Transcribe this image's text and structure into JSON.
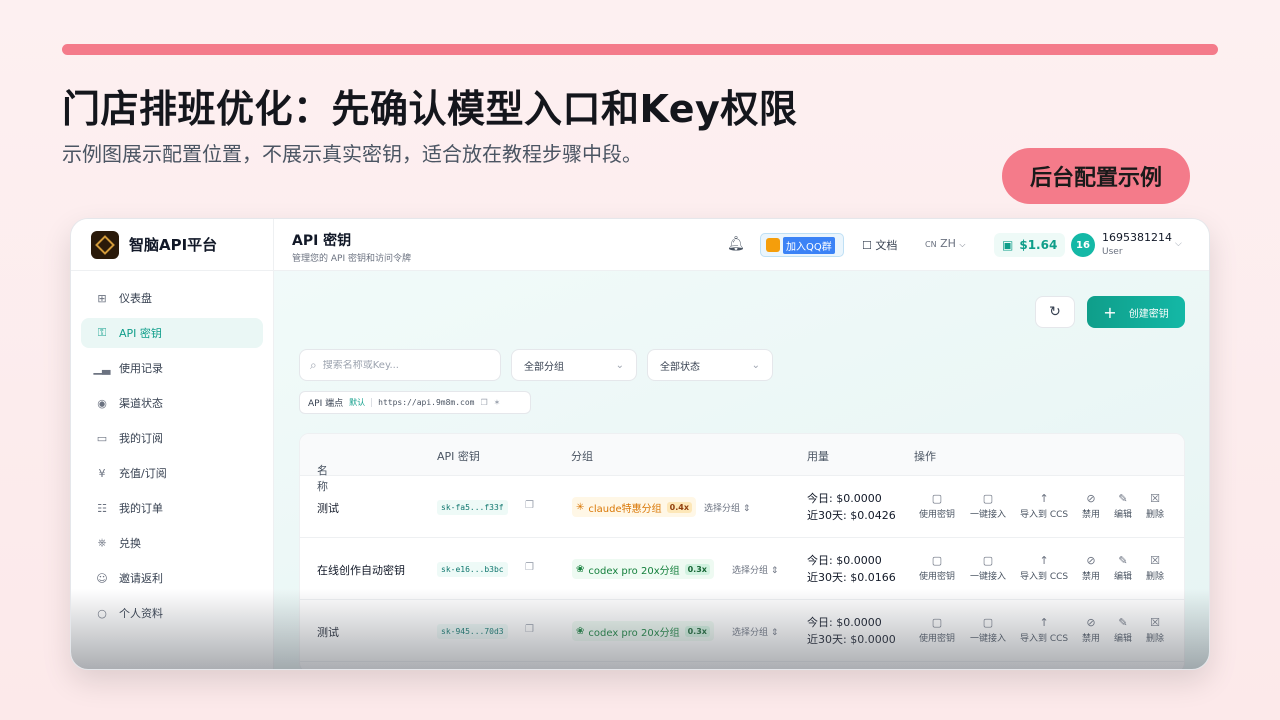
{
  "slide": {
    "headline": "门店排班优化：先确认模型入口和Key权限",
    "subline": "示例图展示配置位置，不展示真实密钥，适合放在教程步骤中段。",
    "pill": "后台配置示例",
    "accent": "#f47b8a"
  },
  "app": {
    "brand": "智脑API平台",
    "nav": [
      {
        "label": "仪表盘",
        "icon": "dashboard-icon"
      },
      {
        "label": "API 密钥",
        "icon": "key-icon",
        "active": true
      },
      {
        "label": "使用记录",
        "icon": "bar-chart-icon"
      },
      {
        "label": "渠道状态",
        "icon": "signal-icon"
      },
      {
        "label": "我的订阅",
        "icon": "card-icon"
      },
      {
        "label": "充值/订阅",
        "icon": "yen-icon"
      },
      {
        "label": "我的订单",
        "icon": "document-icon"
      },
      {
        "label": "兑换",
        "icon": "gift-icon"
      },
      {
        "label": "邀请返利",
        "icon": "users-icon"
      },
      {
        "label": "个人资料",
        "icon": "user-icon"
      }
    ],
    "header": {
      "title": "API 密钥",
      "subtitle": "管理您的 API 密钥和访问令牌",
      "qq": "加入QQ群",
      "docs": "文档",
      "lang": "ZH",
      "lang_prefix": "CN",
      "balance": "$1.64",
      "avatar": "16",
      "user": "1695381214",
      "role": "User"
    },
    "toolbar": {
      "create": "创建密钥",
      "search_placeholder": "搜索名称或Key...",
      "group_filter": "全部分组",
      "status_filter": "全部状态",
      "endpoint_label": "API 端点",
      "endpoint_tag": "默认",
      "endpoint_url": "https://api.9m8m.com"
    },
    "table": {
      "headers": {
        "name": "名称",
        "key": "API 密钥",
        "group": "分组",
        "usage": "用量",
        "actions": "操作"
      },
      "choose_group": "选择分组",
      "actions": [
        "使用密钥",
        "一键接入",
        "导入到 CCS",
        "禁用",
        "编辑",
        "删除"
      ],
      "rows": [
        {
          "name": "测试",
          "key": "sk-fa5...f33f",
          "group": "claude特惠分组",
          "multiplier": "0.4x",
          "today": "今日: $0.0000",
          "month": "近30天: $0.0426"
        },
        {
          "name": "在线创作自动密钥",
          "key": "sk-e16...b3bc",
          "group": "codex pro 20x分组",
          "multiplier": "0.3x",
          "today": "今日: $0.0000",
          "month": "近30天: $0.0166"
        },
        {
          "name": "测试",
          "key": "sk-945...70d3",
          "group": "codex pro 20x分组",
          "multiplier": "0.3x",
          "today": "今日: $0.0000",
          "month": "近30天: $0.0000"
        }
      ]
    }
  }
}
